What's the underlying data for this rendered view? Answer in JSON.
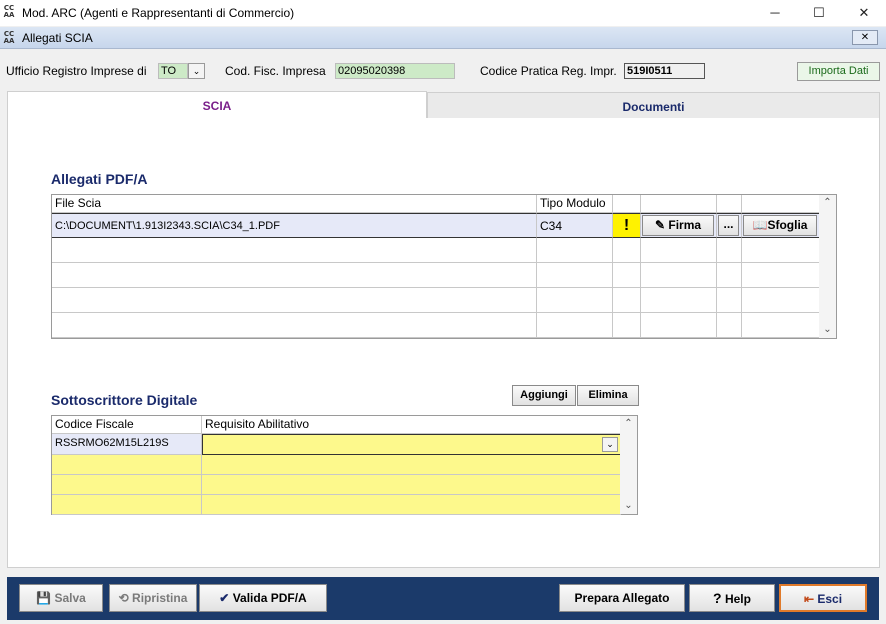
{
  "window": {
    "title": "Mod. ARC (Agenti e Rappresentanti di Commercio)",
    "logo": "CC AA",
    "minimize": "─",
    "maximize": "☐",
    "close": "✕"
  },
  "subwindow": {
    "title": "Allegati SCIA",
    "close": "✕"
  },
  "header": {
    "ufficio_label": "Ufficio Registro Imprese di",
    "ufficio_value": "TO",
    "codfisc_label": "Cod. Fisc. Impresa",
    "codfisc_value": "02095020398",
    "codpratica_label": "Codice Pratica Reg. Impr.",
    "codpratica_value": "519I0511",
    "importa_label": "Importa Dati"
  },
  "tabs": [
    {
      "label": "SCIA",
      "active": true
    },
    {
      "label": "Documenti",
      "active": false
    }
  ],
  "allegati": {
    "title": "Allegati PDF/A",
    "columns": [
      "File Scia",
      "Tipo Modulo"
    ],
    "row": {
      "file": "C:\\DOCUMENT\\1.913I2343.SCIA\\C34_1.PDF",
      "tipo": "C34",
      "warning": "!",
      "firma_label": "Firma",
      "dots_label": "...",
      "sfoglia_label": "Sfoglia"
    }
  },
  "sottoscrittore": {
    "title": "Sottoscrittore Digitale",
    "aggiungi_label": "Aggiungi",
    "elimina_label": "Elimina",
    "columns": [
      "Codice Fiscale",
      "Requisito Abilitativo"
    ],
    "row": {
      "codice": "RSSRMO62M15L219S",
      "requisito": ""
    }
  },
  "footer": {
    "salva": "Salva",
    "ripristina": "Ripristina",
    "valida": "Valida PDF/A",
    "prepara": "Prepara Allegato",
    "help": "Help",
    "esci": "Esci"
  },
  "colors": {
    "footer_bg": "#1b3a6a",
    "yellow": "#fdf98c",
    "selected_row": "#e6e9f8",
    "green_field": "#cdeac7"
  }
}
